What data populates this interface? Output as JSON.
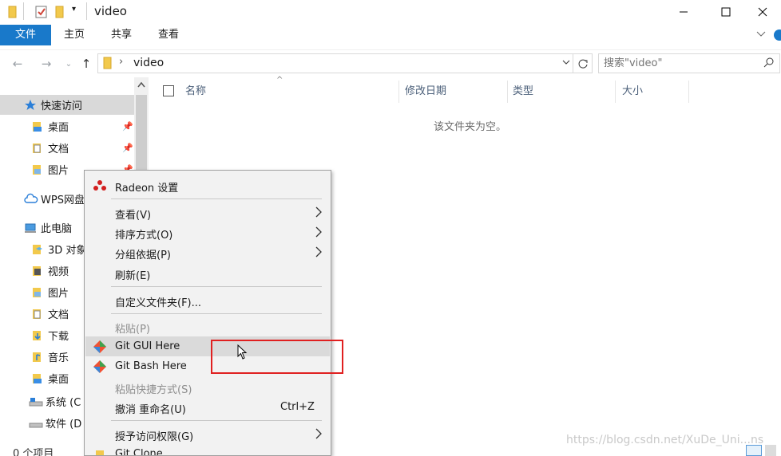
{
  "window": {
    "title": "video",
    "controls": [
      "minimize",
      "maximize",
      "close"
    ]
  },
  "ribbon": {
    "tabs": [
      "文件",
      "主页",
      "共享",
      "查看"
    ]
  },
  "address": {
    "path": "video",
    "search_placeholder": "搜索\"video\""
  },
  "nav_pane": {
    "items": [
      {
        "label": "快速访问",
        "icon": "star-icon"
      },
      {
        "label": "桌面",
        "icon": "desktop-folder-icon",
        "pinned": true
      },
      {
        "label": "文档",
        "icon": "documents-folder-icon",
        "pinned": true
      },
      {
        "label": "图片",
        "icon": "pictures-folder-icon",
        "pinned": true
      },
      {
        "label": "WPS网盘",
        "icon": "cloud-icon"
      },
      {
        "label": "此电脑",
        "icon": "computer-icon"
      },
      {
        "label": "3D 对象",
        "icon": "3d-objects-icon"
      },
      {
        "label": "视频",
        "icon": "videos-folder-icon"
      },
      {
        "label": "图片",
        "icon": "pictures-folder-icon"
      },
      {
        "label": "文档",
        "icon": "documents-folder-icon"
      },
      {
        "label": "下载",
        "icon": "downloads-folder-icon"
      },
      {
        "label": "音乐",
        "icon": "music-folder-icon"
      },
      {
        "label": "桌面",
        "icon": "desktop-folder-icon"
      },
      {
        "label": "系统 (C",
        "icon": "drive-c-icon"
      },
      {
        "label": "软件 (D",
        "icon": "drive-d-icon"
      }
    ]
  },
  "content": {
    "columns": [
      "名称",
      "修改日期",
      "类型",
      "大小"
    ],
    "empty_text": "该文件夹为空。"
  },
  "status_bar": {
    "item_count": "0 个项目"
  },
  "context_menu": {
    "items": [
      {
        "label": "Radeon 设置",
        "icon": "radeon-icon"
      },
      {
        "label": "查看(V)",
        "submenu": true
      },
      {
        "label": "排序方式(O)",
        "submenu": true
      },
      {
        "label": "分组依据(P)",
        "submenu": true
      },
      {
        "label": "刷新(E)"
      },
      {
        "label": "自定义文件夹(F)..."
      },
      {
        "label": "粘贴(P)",
        "disabled": true
      },
      {
        "label": "Git GUI Here",
        "icon": "git-icon",
        "hovered": true
      },
      {
        "label": "Git Bash Here",
        "icon": "git-icon"
      },
      {
        "label": "粘贴快捷方式(S)",
        "disabled": true
      },
      {
        "label": "撤消 重命名(U)",
        "shortcut": "Ctrl+Z"
      },
      {
        "label": "授予访问权限(G)",
        "submenu": true
      },
      {
        "label": "Git Clone",
        "icon": "git-clone-icon"
      }
    ]
  },
  "watermark": "https://blog.csdn.net/XuDe_Uni...ns",
  "colors": {
    "accent": "#1979ca",
    "highlight_box": "#e02020",
    "menu_bg": "#f2f2f2",
    "menu_hover": "#dadada"
  }
}
